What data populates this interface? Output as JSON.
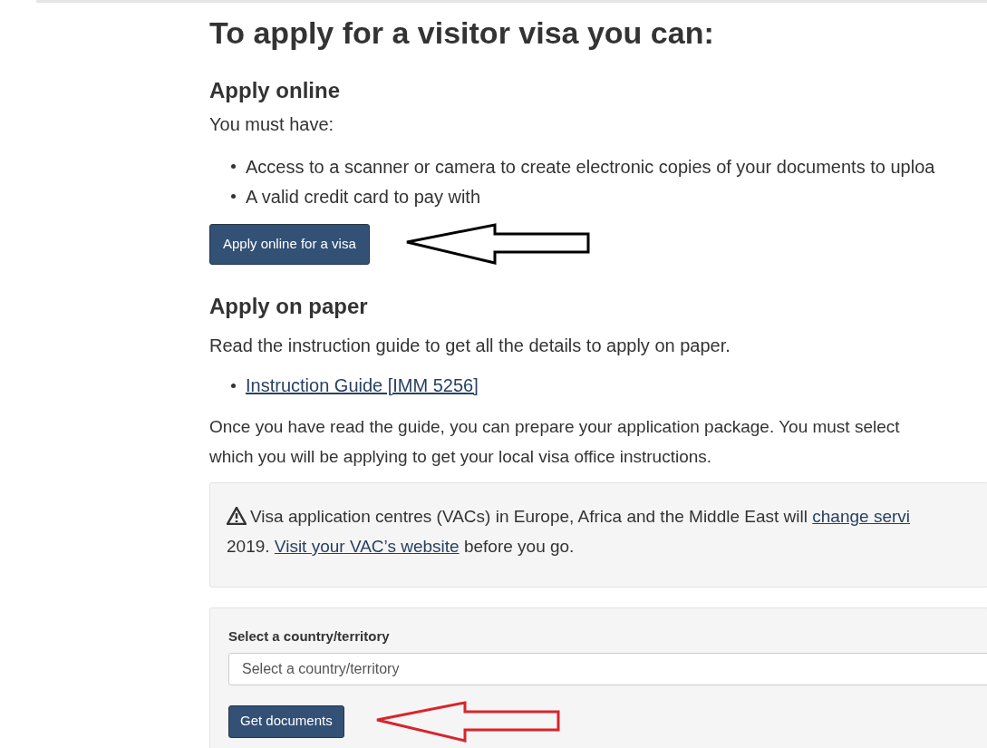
{
  "title": "To apply for a visitor visa you can:",
  "online": {
    "heading": "Apply online",
    "intro": "You must have:",
    "bullets": [
      "Access to a scanner or camera to create electronic copies of your documents to uploa",
      "A valid credit card to pay with"
    ],
    "button": "Apply online for a visa"
  },
  "paper": {
    "heading": "Apply on paper",
    "intro": "Read the instruction guide to get all the details to apply on paper.",
    "links": [
      "Instruction Guide [IMM 5256]"
    ],
    "lines": [
      "Once you have read the guide, you can prepare your application package. You must select",
      "which you will be applying to get your local visa office instructions."
    ]
  },
  "alert": {
    "lines": [
      [
        {
          "text": "Visa application centres (VACs) in Europe, Africa and the Middle East will ",
          "link": false
        },
        {
          "text": "change servi",
          "link": true
        }
      ],
      [
        {
          "text": "2019. ",
          "link": false
        },
        {
          "text": "Visit your VAC’s website",
          "link": true
        },
        {
          "text": " before you go.",
          "link": false
        }
      ]
    ]
  },
  "selector": {
    "label": "Select a country/territory",
    "placeholder": "Select a country/territory",
    "button": "Get documents"
  },
  "arrows": [
    {
      "color": "#000000"
    },
    {
      "color": "#d9242b"
    }
  ]
}
